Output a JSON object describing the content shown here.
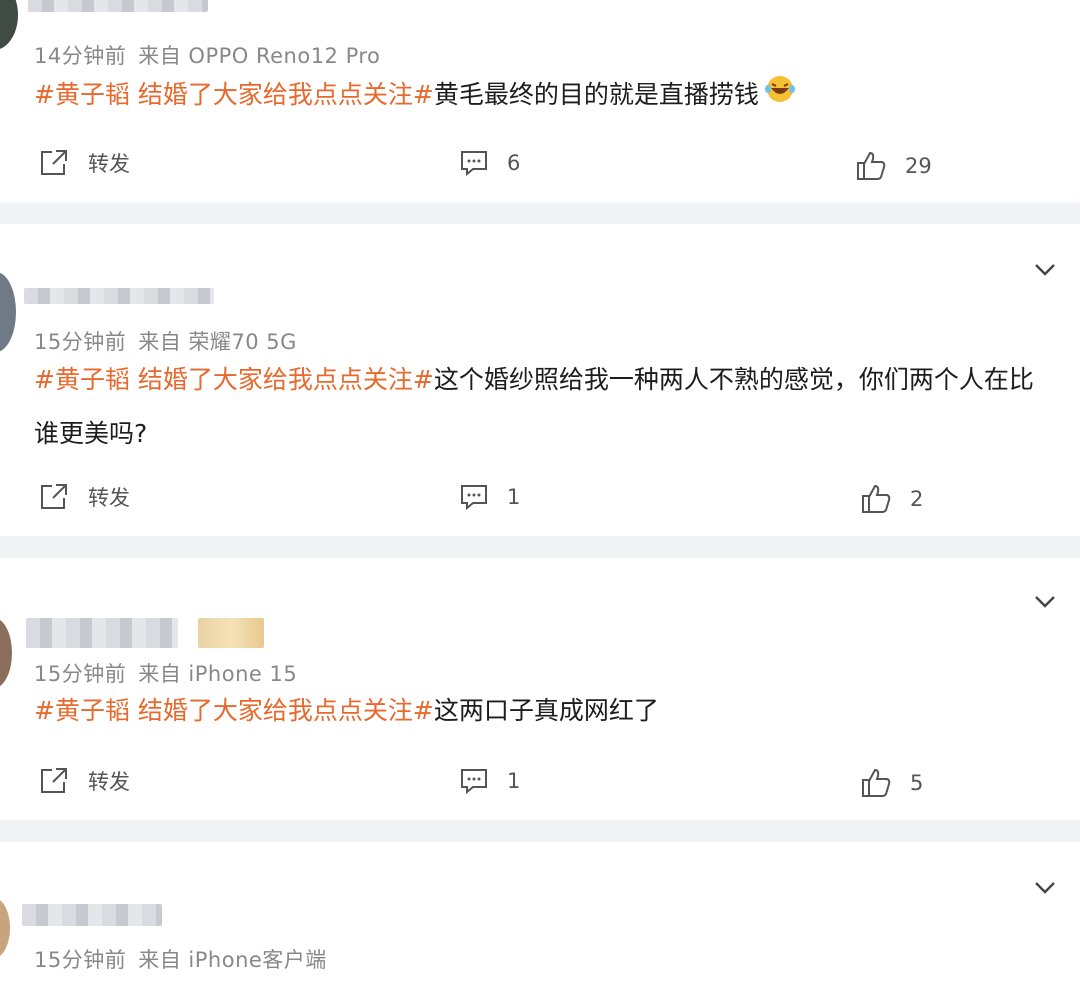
{
  "colors": {
    "accent": "#e8692d",
    "muted": "#888888",
    "background": "#f2f3f5",
    "card": "#ffffff"
  },
  "icons": {
    "repost": "share-square-icon",
    "comment": "comment-icon",
    "like": "thumbs-up-icon",
    "expand": "chevron-down-icon",
    "emoji": "laughing-emoji-icon"
  },
  "comments": [
    {
      "time": "14分钟前",
      "source": "来自 OPPO Reno12 Pro",
      "tag": "#黄子韬 结婚了大家给我点点关注#",
      "text": "黄毛最终的目的就是直播捞钱",
      "repost_label": "转发",
      "comment_count": "6",
      "like_count": "29"
    },
    {
      "time": "15分钟前",
      "source": "来自 荣耀70 5G",
      "tag": "#黄子韬 结婚了大家给我点点关注#",
      "text": "这个婚纱照给我一种两人不熟的感觉，你们两个人在比谁更美吗?",
      "repost_label": "转发",
      "comment_count": "1",
      "like_count": "2"
    },
    {
      "time": "15分钟前",
      "source": "来自 iPhone 15",
      "tag": "#黄子韬 结婚了大家给我点点关注#",
      "text": "这两口子真成网红了",
      "repost_label": "转发",
      "comment_count": "1",
      "like_count": "5"
    },
    {
      "time": "15分钟前",
      "source": "来自 iPhone客户端"
    }
  ]
}
